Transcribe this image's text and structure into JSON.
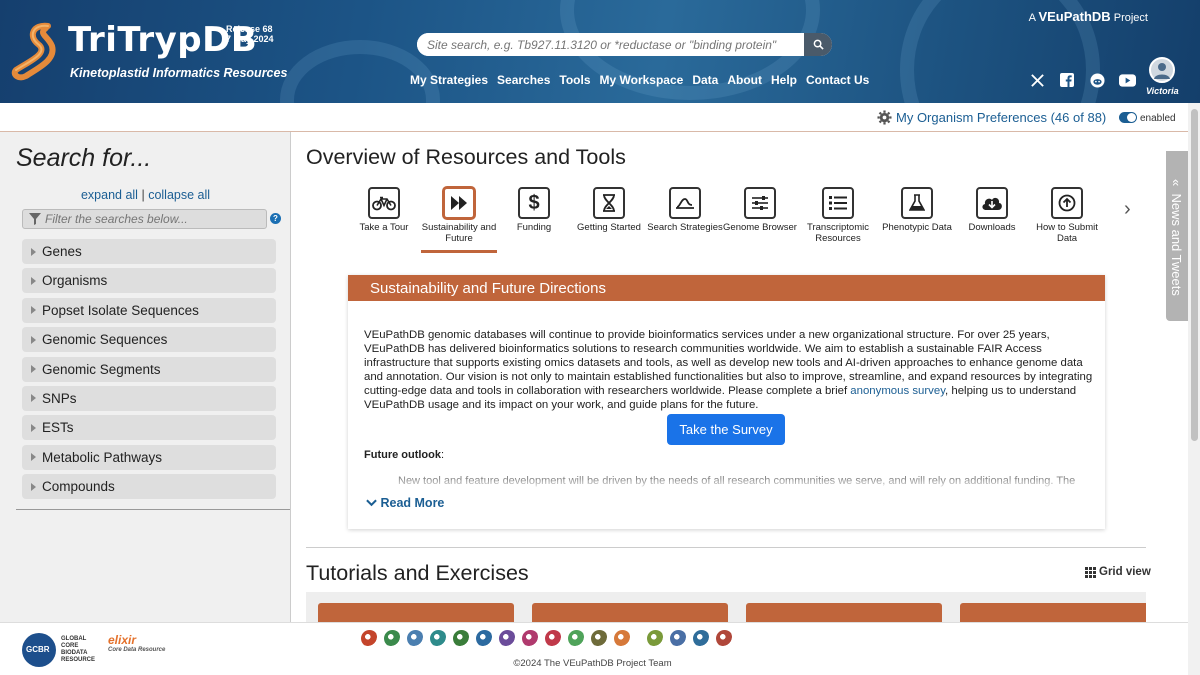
{
  "header": {
    "site_name": "TriTrypDB",
    "tagline": "Kinetoplastid Informatics Resources",
    "release": "Release 68",
    "release_date": "7 May 2024",
    "search_placeholder": "Site search, e.g. Tb927.11.3120 or *reductase or \"binding protein\"",
    "nav": [
      "My Strategies",
      "Searches",
      "Tools",
      "My Workspace",
      "Data",
      "About",
      "Help",
      "Contact Us"
    ],
    "project_prefix": "A",
    "project_name": "VEuPathDB",
    "project_suffix": "Project",
    "user_name": "Victoria",
    "social_icons": [
      "x-icon",
      "facebook-icon",
      "reddit-icon",
      "youtube-icon"
    ]
  },
  "prefs": {
    "label": "My Organism Preferences (46 of 88)",
    "toggle_label": "enabled",
    "toggle_on": true
  },
  "sidebar": {
    "title": "Search for...",
    "expand_all": "expand all",
    "separator": "|",
    "collapse_all": "collapse all",
    "filter_placeholder": "Filter the searches below...",
    "items": [
      "Genes",
      "Organisms",
      "Popset Isolate Sequences",
      "Genomic Sequences",
      "Genomic Segments",
      "SNPs",
      "ESTs",
      "Metabolic Pathways",
      "Compounds"
    ]
  },
  "main": {
    "title": "Overview of Resources and Tools",
    "tools": [
      {
        "label": "Take a Tour",
        "icon": "bicycle-icon"
      },
      {
        "label": "Sustainability and Future",
        "icon": "fast-forward-icon"
      },
      {
        "label": "Funding",
        "icon": "dollar-icon"
      },
      {
        "label": "Getting Started",
        "icon": "hourglass-icon"
      },
      {
        "label": "Search Strategies",
        "icon": "strategies-icon"
      },
      {
        "label": "Genome Browser",
        "icon": "sliders-icon"
      },
      {
        "label": "Transcriptomic Resources",
        "icon": "list-icon"
      },
      {
        "label": "Phenotypic Data",
        "icon": "flask-icon"
      },
      {
        "label": "Downloads",
        "icon": "cloud-download-icon"
      },
      {
        "label": "How to Submit Data",
        "icon": "upload-circle-icon"
      }
    ],
    "active_tool_index": 1,
    "panel": {
      "title": "Sustainability and Future Directions",
      "body": "VEuPathDB genomic databases will continue to provide bioinformatics services under a new organizational structure. For over 25 years, VEuPathDB has delivered bioinformatics solutions to research communities worldwide. We aim to establish a sustainable FAIR Access infrastructure that supports existing omics datasets and tools, as well as develop new tools and AI-driven approaches to enhance genome data and annotation. Our vision is not only to maintain established functionalities but also to improve, streamline, and expand resources by integrating cutting-edge data and tools in collaboration with researchers worldwide. Please complete a brief",
      "link_text": "anonymous survey",
      "body_end": ", helping us to understand VEuPathDB usage and its impact on your work, and guide plans for the future.",
      "button": "Take the Survey",
      "future_label": "Future outlook",
      "future_colon": ":",
      "future_text": "New tool and feature development will be driven by the needs of all research communities we serve, and will rely on additional funding. The",
      "read_more": "Read More"
    },
    "tutorials_title": "Tutorials and Exercises",
    "grid_view": "Grid view"
  },
  "news_tab": "News and Tweets",
  "footer": {
    "gcbr_text": [
      "GLOBAL",
      "CORE",
      "BIODATA",
      "RESOURCE"
    ],
    "gcbr_logo_text": "GCBR",
    "elixir": "elixir",
    "elixir_sub": "Core Data Resource",
    "copyright": "©2024 The VEuPathDB Project Team",
    "org_colors": [
      "#c4452b",
      "#3b8a4c",
      "#4b7fb0",
      "#2e8b8b",
      "#3a7d3a",
      "#2c6aa0",
      "#6b4c9a",
      "#b03a6e",
      "#c0394a",
      "#4fa35a",
      "#6e6b3a",
      "#d6793a",
      "#7a9a3a",
      "#4a6fa5",
      "#2f6d9a",
      "#b0473a"
    ]
  },
  "colors": {
    "accent": "#c0653b",
    "link": "#1b5e93",
    "button": "#1a73e8",
    "header_bg": "#1c5486"
  }
}
